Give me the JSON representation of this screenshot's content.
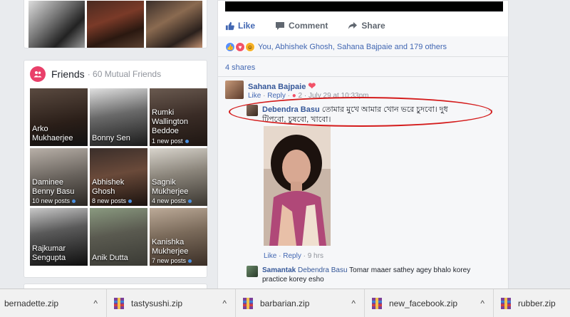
{
  "friends": {
    "title": "Friends",
    "mutual": "· 60 Mutual Friends",
    "tiles": [
      {
        "name": "Arko Mukhaerjee",
        "posts": ""
      },
      {
        "name": "Bonny Sen",
        "posts": ""
      },
      {
        "name": "Rumki Wallington Beddoe",
        "posts": "1 new post"
      },
      {
        "name": "Daminee Benny Basu",
        "posts": "10 new posts"
      },
      {
        "name": "Abhishek Ghosh",
        "posts": "8 new posts"
      },
      {
        "name": "Sagnik Mukherjee",
        "posts": "4 new posts"
      },
      {
        "name": "Rajkumar Sengupta",
        "posts": ""
      },
      {
        "name": "Anik Dutta",
        "posts": ""
      },
      {
        "name": "Kanishka Mukherjee",
        "posts": "7 new posts"
      }
    ]
  },
  "post": {
    "actions": {
      "like": "Like",
      "comment": "Comment",
      "share": "Share"
    },
    "reactions_text": "You, Abhishek Ghosh, Sahana Bajpaie and 179 others",
    "shares": "4 shares"
  },
  "comments": {
    "c1": {
      "name": "Sahana Bajpaie",
      "like": "Like",
      "reply": "Reply",
      "count": "2",
      "time": "· July 29 at 10:33pm"
    },
    "c2": {
      "name": "Debendra Basu",
      "text": "তোমার মুখে আমার খোন ভরে চুদবো। দুধ টিপবো, চুষবো, খাবো।",
      "like": "Like",
      "reply": "Reply",
      "time": "· 9 hrs"
    },
    "c3": {
      "name": "Samantak",
      "tag": "Debendra Basu",
      "text": "Tomar maaer sathey agey bhalo korey practice korey esho"
    }
  },
  "downloads": [
    "bernadette.zip",
    "tastysushi.zip",
    "barbarian.zip",
    "new_facebook.zip",
    "rubber.zip"
  ],
  "colors": {
    "fb_blue": "#4267b2",
    "link": "#365899",
    "highlight": "#d41c1c"
  }
}
